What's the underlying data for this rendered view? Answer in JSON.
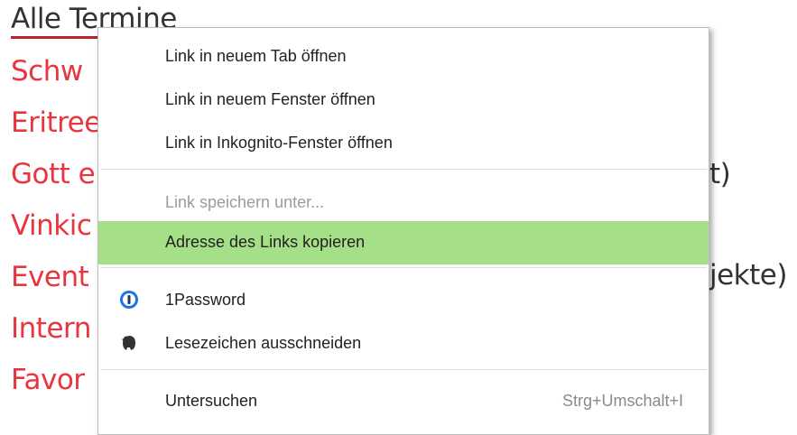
{
  "background": {
    "links": [
      "Alle Termine",
      "Schw",
      "Eritree",
      "Gott e",
      "Vinkic",
      "Event",
      "Intern",
      "Favor"
    ],
    "tail_texts": [
      "t)",
      "jekte)"
    ]
  },
  "context_menu": {
    "items": [
      {
        "label": "Link in neuem Tab öffnen"
      },
      {
        "label": "Link in neuem Fenster öffnen"
      },
      {
        "label": "Link in Inkognito-Fenster öffnen"
      },
      {
        "label": "Link speichern unter...",
        "disabled": true
      },
      {
        "label": "Adresse des Links kopieren",
        "highlighted": true
      },
      {
        "label": "1Password",
        "icon": "1password-icon"
      },
      {
        "label": "Lesezeichen ausschneiden",
        "icon": "evernote-elephant-icon"
      },
      {
        "label": "Untersuchen",
        "shortcut": "Strg+Umschalt+I"
      }
    ]
  },
  "colors": {
    "link_red": "#e8353f",
    "highlight_green": "#a5df87"
  }
}
